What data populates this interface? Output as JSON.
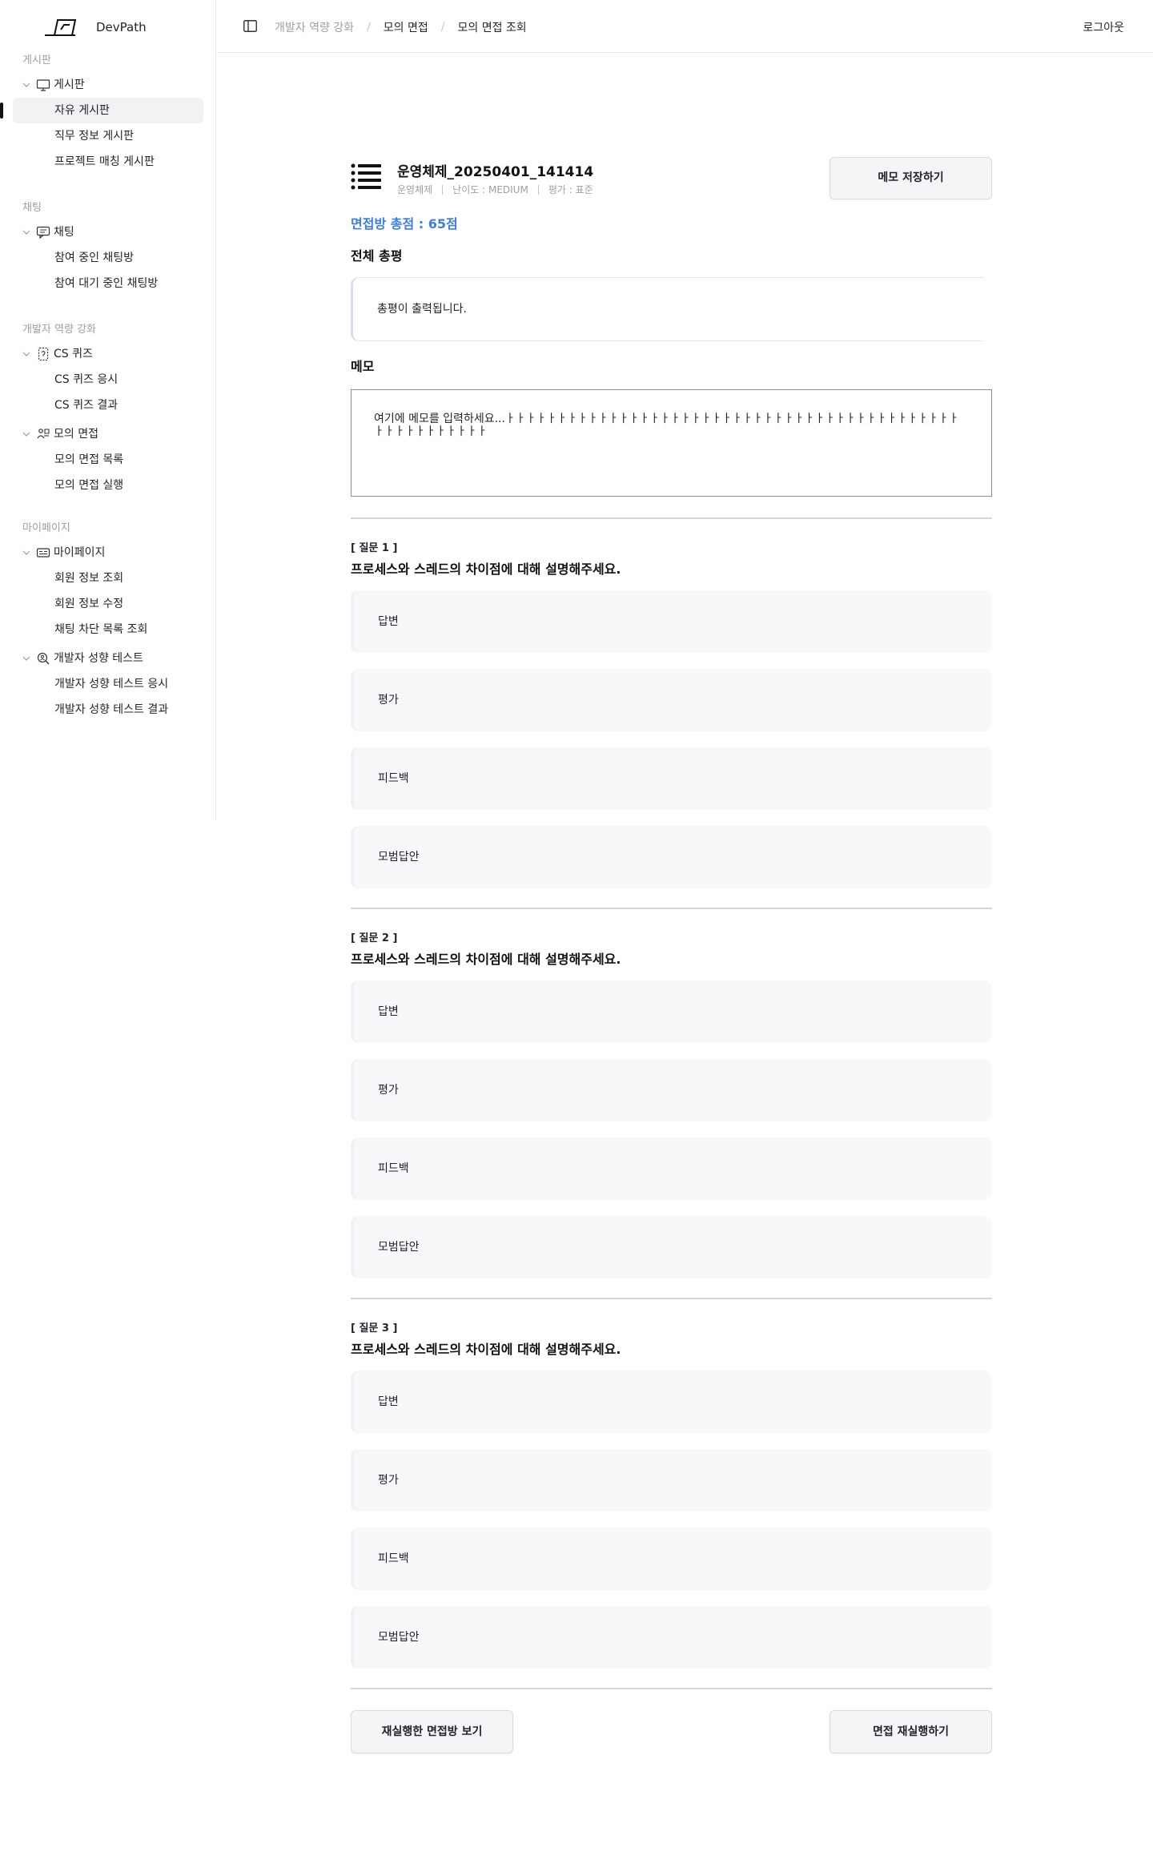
{
  "brand": {
    "name": "DevPath",
    "logo_icon": "devpath-logo-icon"
  },
  "sidebar": {
    "sections": [
      {
        "label": "게시판",
        "group": {
          "label": "게시판",
          "icon": "monitor-icon"
        },
        "items": [
          {
            "label": "자유 게시판",
            "active": true
          },
          {
            "label": "직무 정보 게시판"
          },
          {
            "label": "프로젝트 매칭 게시판"
          }
        ]
      },
      {
        "label": "채팅",
        "group": {
          "label": "채팅",
          "icon": "chat-icon"
        },
        "items": [
          {
            "label": "참여 중인 채팅방"
          },
          {
            "label": "참여 대기 중인 채팅방"
          }
        ]
      },
      {
        "label": "개발자 역량 강화",
        "groups": [
          {
            "label": "CS 퀴즈",
            "icon": "quiz-icon",
            "items": [
              {
                "label": "CS 퀴즈 응시"
              },
              {
                "label": "CS 퀴즈 결과"
              }
            ]
          },
          {
            "label": "모의 면접",
            "icon": "interview-icon",
            "items": [
              {
                "label": "모의 면접 목록"
              },
              {
                "label": "모의 면접 실행"
              }
            ]
          }
        ]
      },
      {
        "label": "마이페이지",
        "groups": [
          {
            "label": "마이페이지",
            "icon": "id-card-icon",
            "items": [
              {
                "label": "회원 정보 조회"
              },
              {
                "label": "회원 정보 수정"
              },
              {
                "label": "채팅 차단 목록 조회"
              }
            ]
          },
          {
            "label": "개발자 성향 테스트",
            "icon": "magnifier-person-icon",
            "items": [
              {
                "label": "개발자 성향 테스트 응시"
              },
              {
                "label": "개발자 성향 테스트 결과"
              }
            ]
          }
        ]
      }
    ]
  },
  "topbar": {
    "breadcrumb": [
      "개발자 역량 강화",
      "모의 면접",
      "모의 면접 조회"
    ],
    "logout_label": "로그아웃"
  },
  "interview": {
    "title": "운영체제_20250401_141414",
    "meta": [
      "운영체제",
      "난이도 : MEDIUM",
      "평가 : 표준"
    ],
    "save_memo_label": "메모 저장하기",
    "total_score": "면접방 총점 : 65점",
    "summary_heading": "전체 총평",
    "summary_text": "총평이 출력됩니다.",
    "memo_heading": "메모",
    "memo_text": "여기에 메모를 입력하세요...ㅏㅏㅏㅏㅏㅏㅏㅏㅏㅏㅏㅏㅏㅏㅏㅏㅏㅏㅏㅏㅏㅏㅏㅏㅏㅏㅏㅏㅏㅏㅏㅏㅏㅏㅏㅏㅏㅏㅏㅏㅏㅏㅏㅏㅏㅏㅏㅏㅏㅏㅏㅏㅏㅏㅏ",
    "questions": [
      {
        "number": "[ 질문 1 ]",
        "text": "프로세스와 스레드의 차이점에 대해 설명해주세요.",
        "cards": [
          "답변",
          "평가",
          "피드백",
          "모범답안"
        ]
      },
      {
        "number": "[ 질문 2 ]",
        "text": "프로세스와 스레드의 차이점에 대해 설명해주세요.",
        "cards": [
          "답변",
          "평가",
          "피드백",
          "모범답안"
        ]
      },
      {
        "number": "[ 질문 3 ]",
        "text": "프로세스와 스레드의 차이점에 대해 설명해주세요.",
        "cards": [
          "답변",
          "평가",
          "피드백",
          "모범답안"
        ]
      }
    ],
    "view_rerun_label": "재실행한 면접방 보기",
    "rerun_label": "면접 재실행하기"
  }
}
